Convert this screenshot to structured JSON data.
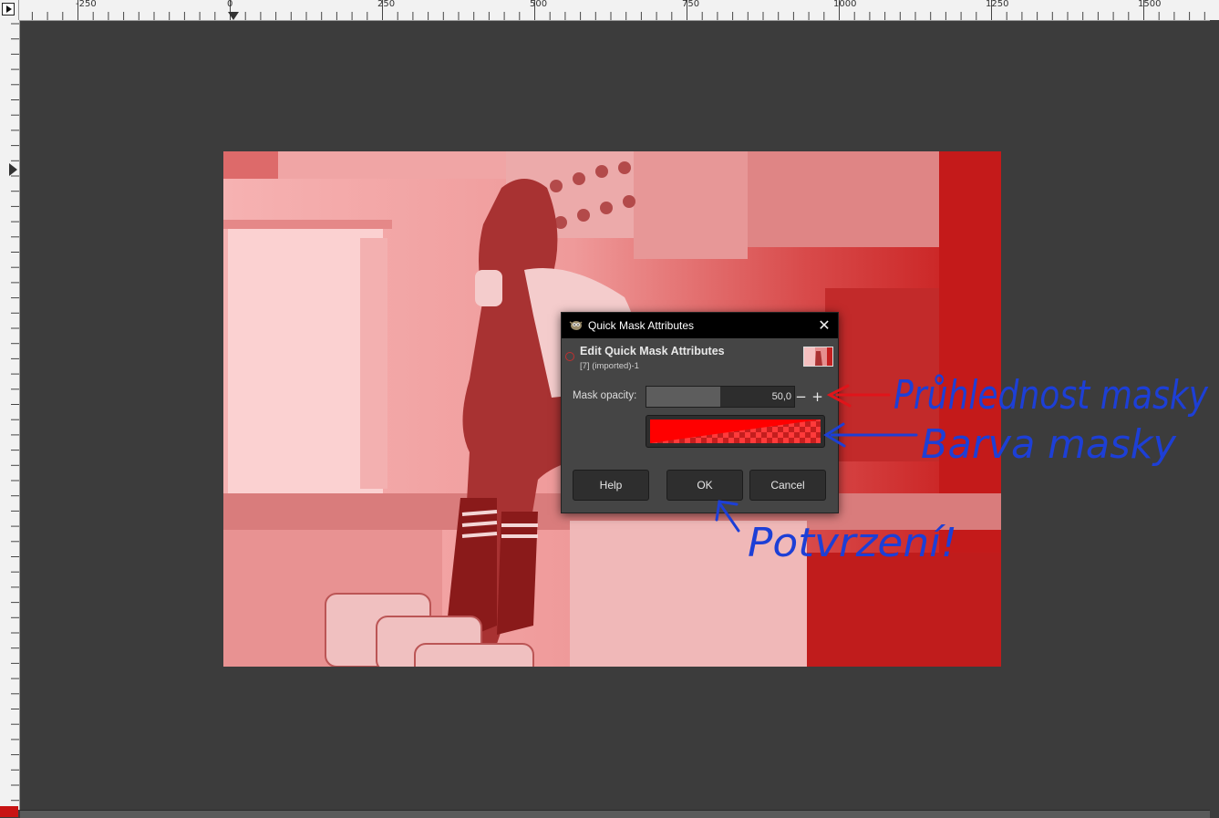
{
  "ruler": {
    "top_labels": [
      "-250",
      "0",
      "250",
      "500",
      "750",
      "1000",
      "1250",
      "1500"
    ]
  },
  "dialog": {
    "title": "Quick Mask Attributes",
    "close_symbol": "✕",
    "header_title": "Edit Quick Mask Attributes",
    "header_subtitle": "[7] (imported)-1",
    "opacity_label": "Mask opacity:",
    "opacity_value": "50,0",
    "opacity_fraction": 0.5,
    "minus_symbol": "−",
    "plus_symbol": "+",
    "mask_color": "#ff0000",
    "help_label": "Help",
    "ok_label": "OK",
    "cancel_label": "Cancel"
  },
  "annotations": {
    "opacity_note": "Průhlednost masky",
    "color_note": "Barva masky",
    "confirm_note": "Potvrzení!",
    "ink_blue": "#1d3fd6",
    "ink_red": "#e0141a"
  },
  "canvas": {
    "tint_color": "#d41a1a"
  }
}
